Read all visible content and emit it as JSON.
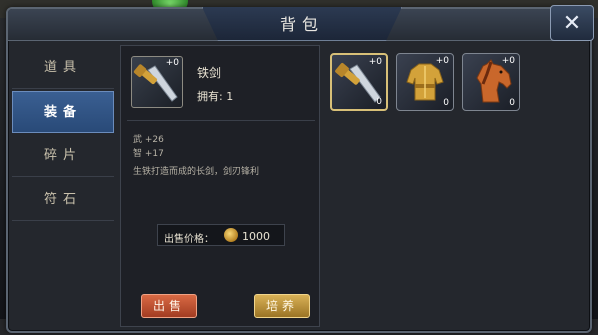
{
  "window": {
    "title": "背包"
  },
  "tabs": [
    {
      "label": "道具",
      "active": false
    },
    {
      "label": "装备",
      "active": true
    },
    {
      "label": "碎片",
      "active": false
    },
    {
      "label": "符石",
      "active": false
    }
  ],
  "detail": {
    "name": "铁剑",
    "plus": "+0",
    "owned": "拥有: 1",
    "stats": [
      "武 +26",
      "智 +17"
    ],
    "description": "生铁打造而成的长剑，剑刃锋利",
    "price_label": "出售价格：",
    "price_value": "1000",
    "sell_label": "出售",
    "train_label": "培养"
  },
  "items": [
    {
      "icon": "sword-icon",
      "plus": "+0",
      "count": "0",
      "selected": true
    },
    {
      "icon": "armor-icon",
      "plus": "+0",
      "count": "0",
      "selected": false
    },
    {
      "icon": "horse-icon",
      "plus": "+0",
      "count": "0",
      "selected": false
    }
  ],
  "colors": {
    "accent": "#3a5f92",
    "sell": "#c4512f",
    "train": "#c39a3f",
    "gold": "#d8c078"
  }
}
